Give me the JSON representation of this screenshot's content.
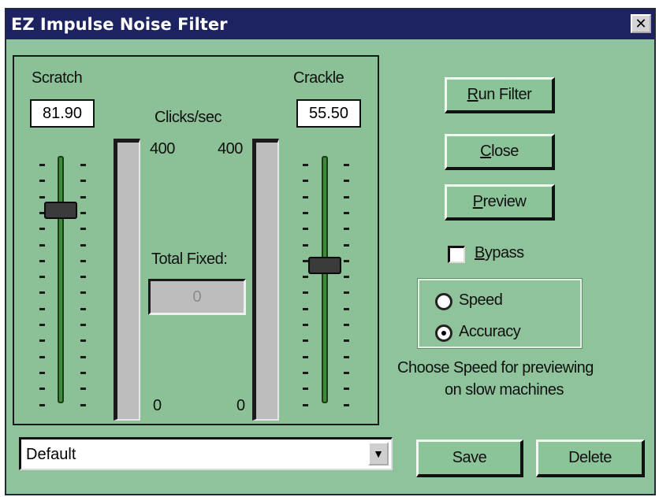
{
  "window": {
    "title": "EZ Impulse Noise Filter",
    "close_glyph": "✕"
  },
  "scratch": {
    "label": "Scratch",
    "value": "81.90",
    "slider_level": 0.8
  },
  "crackle": {
    "label": "Crackle",
    "value": "55.50",
    "slider_level": 0.56
  },
  "meters": {
    "label": "Clicks/sec",
    "left_max": "400",
    "right_max": "400",
    "left_min": "0",
    "right_min": "0",
    "left_level": 0,
    "right_level": 0
  },
  "total_fixed": {
    "label": "Total Fixed:",
    "value": "0"
  },
  "buttons": {
    "run_filter_prefix": "R",
    "run_filter_rest": "un Filter",
    "close_prefix": "C",
    "close_rest": "lose",
    "preview_prefix": "P",
    "preview_rest": "review",
    "save": "Save",
    "delete": "Delete"
  },
  "bypass": {
    "prefix": "B",
    "rest": "ypass",
    "checked": false
  },
  "mode": {
    "speed_label": "Speed",
    "accuracy_label": "Accuracy",
    "selected": "Accuracy",
    "hint_line1": "Choose Speed for previewing",
    "hint_line2": "on slow machines"
  },
  "preset": {
    "selected": "Default"
  },
  "colors": {
    "background": "#8fc39b",
    "titlebar": "#1d2360",
    "slider_track": "#3f8a38"
  },
  "icons": {
    "close": "close-icon",
    "dropdown": "chevron-down-icon"
  }
}
